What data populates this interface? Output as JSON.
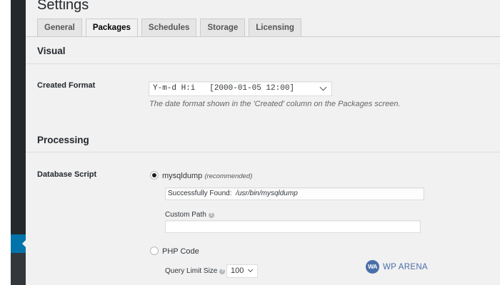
{
  "page": {
    "title": "Settings"
  },
  "tabs": [
    "General",
    "Packages",
    "Schedules",
    "Storage",
    "Licensing"
  ],
  "visual": {
    "heading": "Visual",
    "created_format": {
      "label": "Created Format",
      "value": "Y-m-d H:i   [2000-01-05 12:00]",
      "description": "The date format shown in the 'Created' column on the Packages screen."
    }
  },
  "processing": {
    "heading": "Processing",
    "database_script": {
      "label": "Database Script",
      "mysqldump": {
        "label": "mysqldump",
        "note": "(recommended)",
        "checked": true,
        "found_label": "Successfully Found:",
        "found_path": "/usr/bin/mysqldump",
        "custom_path_label": "Custom Path",
        "custom_path_value": ""
      },
      "php_code": {
        "label": "PHP Code",
        "checked": false,
        "query_limit_label": "Query Limit Size",
        "query_limit_value": "100"
      }
    }
  },
  "watermark": {
    "logo": "WA",
    "text": "WP ARENA"
  },
  "colors": {
    "admin_bar": "#23282d",
    "admin_active": "#0073aa",
    "content_bg": "#f1f1f1",
    "watermark": "#4a6ea9"
  },
  "icons": [
    "chevron-down-icon",
    "help-icon",
    "radio-icon"
  ]
}
